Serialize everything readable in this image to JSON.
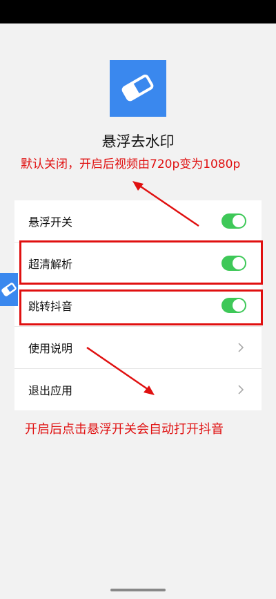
{
  "app": {
    "title": "悬浮去水印",
    "icon": "eraser-icon",
    "brand_color": "#3a88ee"
  },
  "annotations": {
    "top_note": "默认关闭，开启后视频由720p变为1080p",
    "bottom_note": "开启后点击悬浮开关会自动打开抖音",
    "color": "#e01010"
  },
  "settings": {
    "toggles": [
      {
        "label": "悬浮开关",
        "on": true
      },
      {
        "label": "超清解析",
        "on": true
      },
      {
        "label": "跳转抖音",
        "on": true
      }
    ],
    "links": [
      {
        "label": "使用说明",
        "icon": "chevron-right-icon"
      },
      {
        "label": "退出应用",
        "icon": "chevron-right-icon"
      }
    ],
    "toggle_color": "#3ec858"
  },
  "floating_button": {
    "icon": "eraser-icon"
  }
}
